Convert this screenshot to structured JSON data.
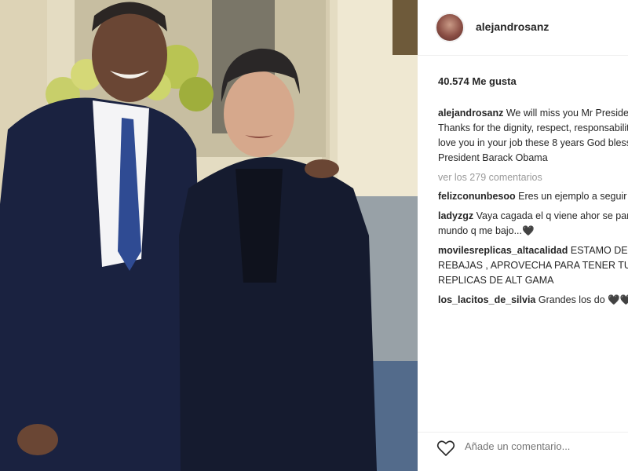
{
  "post": {
    "username": "alejandrosanz",
    "likes_text": "40.574 Me gusta",
    "caption_user": "alejandrosanz",
    "caption_text": "We will miss you Mr President. Thanks for the dignity, respect, responsability and love you in your job these 8 years God bless y Mr. President Barack Obama",
    "view_all_comments": "ver los 279 comentarios",
    "comments": [
      {
        "user": "felizconunbesoo",
        "text": "Eres un ejemplo a seguir 🖤"
      },
      {
        "user": "ladyzgz",
        "text": "Vaya cagada el q viene ahor se pare el mundo q me bajo...🖤"
      },
      {
        "user": "movilesreplicas_altacalidad",
        "text": "ESTAMO DE REBAJAS , APROVECHA PARA TENER TU MOVIL , REPLICAS DE ALT GAMA"
      },
      {
        "user": "los_lacitos_de_silvia",
        "text": "Grandes los do 🖤🖤🖤🖤"
      }
    ],
    "add_comment_placeholder": "Añade un comentario..."
  },
  "icons": {
    "like": "heart-outline-icon",
    "avatar": "profile-avatar"
  },
  "colors": {
    "text": "#262626",
    "muted": "#999999",
    "suit": "#16203a"
  }
}
